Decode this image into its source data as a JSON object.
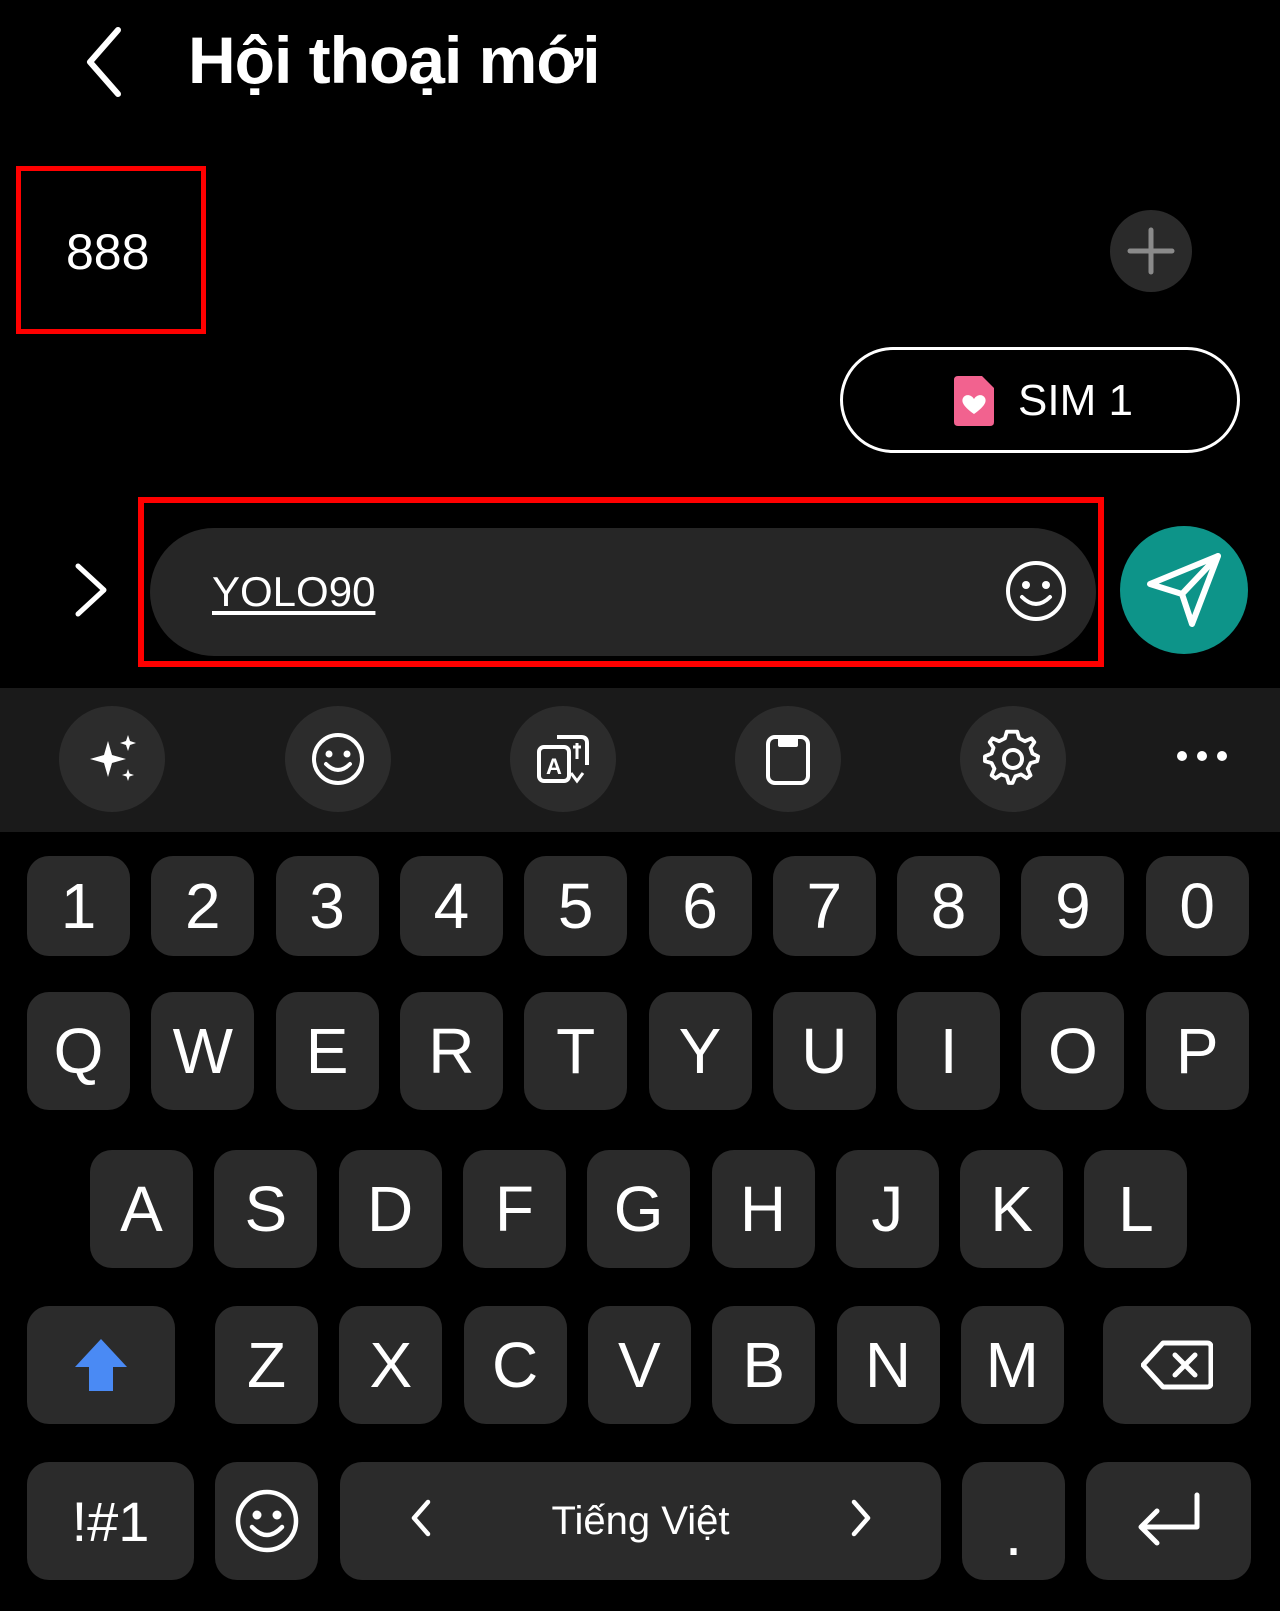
{
  "header": {
    "title": "Hội thoại mới"
  },
  "recipient": {
    "value": "888"
  },
  "sim": {
    "label": "SIM 1",
    "icon": "sim-card-heart-icon",
    "icon_color": "#f2628f"
  },
  "compose": {
    "text": "YOLO90"
  },
  "toolbar": {
    "items": [
      "sparkle-ai-icon",
      "emoji-icon",
      "translate-icon",
      "clipboard-icon",
      "settings-gear-icon",
      "more-horizontal-icon"
    ]
  },
  "keyboard": {
    "row_numbers": [
      "1",
      "2",
      "3",
      "4",
      "5",
      "6",
      "7",
      "8",
      "9",
      "0"
    ],
    "row_top": [
      "Q",
      "W",
      "E",
      "R",
      "T",
      "Y",
      "U",
      "I",
      "O",
      "P"
    ],
    "row_middle": [
      "A",
      "S",
      "D",
      "F",
      "G",
      "H",
      "J",
      "K",
      "L"
    ],
    "row_bottom": [
      "Z",
      "X",
      "C",
      "V",
      "B",
      "N",
      "M"
    ],
    "symbols_key": "!#1",
    "space_label": "Tiếng Việt",
    "period_key": "."
  },
  "colors": {
    "background": "#000000",
    "key": "#2b2b2b",
    "send": "#0d9489",
    "highlight": "#ff0000",
    "shift": "#4a8af4"
  }
}
